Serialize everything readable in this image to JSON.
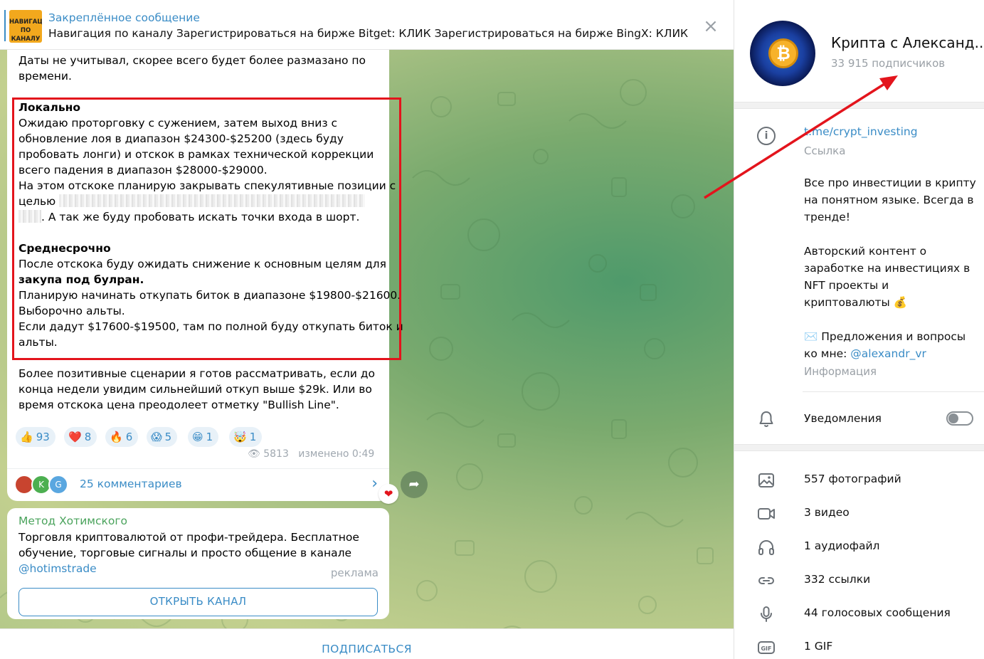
{
  "pinned": {
    "title": "Закреплённое сообщение",
    "thumb_text": "НАВИГАЦИЯ ПО КАНАЛУ",
    "text": "Навигация по каналу  Зарегистрироваться на бирже Bitget: КЛИК  Зарегистрироваться на бирже BingX: КЛИК  …",
    "close_icon": "close-icon"
  },
  "post": {
    "lines": [
      "Даты не учитывал, скорее всего будет более размазано по",
      "времени.",
      "Локально",
      "Ожидаю проторговку с сужением, затем выход вниз с",
      "обновление лоя в диапазон $24300-$25200 (здесь буду",
      "пробовать лонги) и отскок в рамках технической коррекции",
      "всего падения в диапазон $28000-$29000.",
      "На этом отскоке планирую закрывать спекулятивные позиции с",
      "целью",
      ". А так же буду пробовать искать точки входа в шорт.",
      "Среднесрочно",
      "После отскока буду ожидать снижение к основным целям для",
      "закупа под булран.",
      "Планирую начинать откупать биток в диапазоне $19800-$21600.",
      "Выборочно альты.",
      "Если дадут $17600-$19500, там по полной буду откупать биток и",
      "альты.",
      "Более позитивные сценарии я готов рассматривать, если до",
      "конца недели увидим сильнейший откуп выше $29k. Или во",
      "время отскока цена преодолеет отметку \"Bullish Line\"."
    ],
    "reactions": [
      {
        "emoji": "👍",
        "count": "93"
      },
      {
        "emoji": "❤️",
        "count": "8"
      },
      {
        "emoji": "🔥",
        "count": "6"
      },
      {
        "emoji": "😱",
        "count": "5"
      },
      {
        "emoji": "😁",
        "count": "1"
      },
      {
        "emoji": "🤯",
        "count": "1"
      }
    ],
    "views": "5813",
    "edited": "изменено 0:49",
    "comments_label": "25 комментариев",
    "comment_avatars": [
      "",
      "K",
      "G"
    ],
    "heart_reaction": "❤"
  },
  "ad": {
    "from": "Метод Хотимского",
    "line1": "Торговля криптовалютой от профи-трейдера. Бесплатное",
    "line2": "обучение, торговые сигналы и просто общение в канале",
    "link": "@hotimstrade",
    "tag": "реклама",
    "button": "ОТКРЫТЬ КАНАЛ"
  },
  "subscribe": "ПОДПИСАТЬСЯ",
  "channel": {
    "name": "Крипта с Александ...",
    "subscribers": "33 915 подписчиков",
    "link": "t.me/crypt_investing",
    "link_caption": "Ссылка",
    "about": [
      "Все про инвестиции в крипту",
      "на понятном языке. Всегда в",
      "тренде!",
      "",
      "Авторский контент о",
      "заработке на инвестициях в",
      "NFT проекты и",
      "криптовалюты 💰",
      "",
      "✉️ Предложения и вопросы",
      "ко мне: "
    ],
    "contact_link": "@alexandr_vr",
    "about_caption": "Информация",
    "notifications": "Уведомления",
    "notifications_on": false,
    "media": [
      {
        "icon": "photo-icon",
        "label": "557 фотографий"
      },
      {
        "icon": "video-icon",
        "label": "3 видео"
      },
      {
        "icon": "headphones-icon",
        "label": "1 аудиофайл"
      },
      {
        "icon": "link-icon",
        "label": "332 ссылки"
      },
      {
        "icon": "microphone-icon",
        "label": "44 голосовых сообщения"
      },
      {
        "icon": "gif-icon",
        "label": "1 GIF"
      }
    ]
  },
  "colors": {
    "accent": "#3a8cc6",
    "highlight_box": "#e3141c",
    "ad_sender": "#4aa35c"
  }
}
